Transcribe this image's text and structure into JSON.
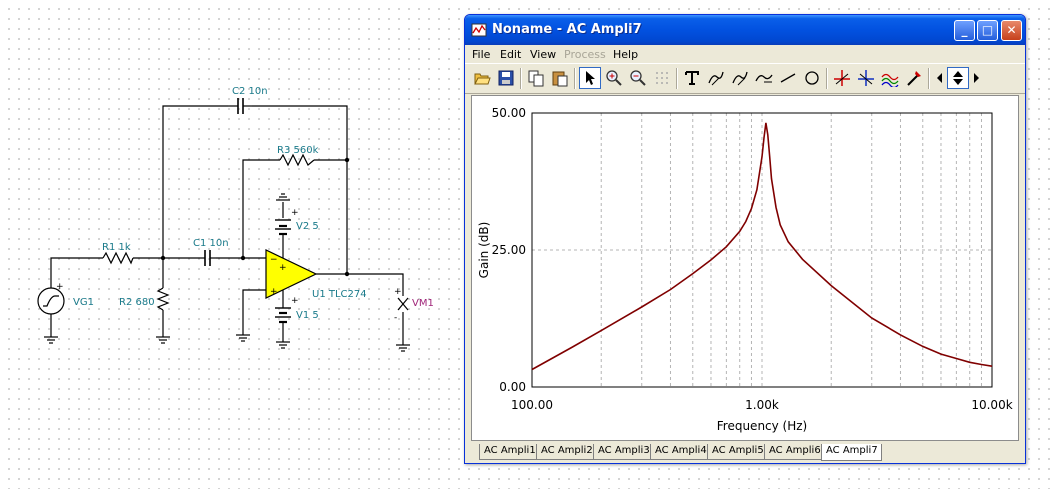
{
  "schematic": {
    "components": {
      "c2": "C2 10n",
      "r3": "R3 560k",
      "v2": "V2 5",
      "r1": "R1 1k",
      "c1": "C1 10n",
      "r2": "R2 680",
      "vg1": "VG1",
      "u1": "U1 TLC274",
      "vm1": "VM1",
      "v1": "V1 5"
    },
    "colors": {
      "wire": "#000000",
      "label": "#1a7a8a",
      "opamp_fill": "#ffff00",
      "meter_label": "#a0267a"
    }
  },
  "window": {
    "title": "Noname - AC Ampli7",
    "controls": {
      "minimize": "_",
      "maximize": "□",
      "close": "✕"
    },
    "menu": [
      {
        "label": "File",
        "enabled": true
      },
      {
        "label": "Edit",
        "enabled": true
      },
      {
        "label": "View",
        "enabled": true
      },
      {
        "label": "Process",
        "enabled": false
      },
      {
        "label": "Help",
        "enabled": true
      }
    ],
    "toolbar_icons": [
      "open-icon",
      "save-icon",
      "copy-icon",
      "paste-icon",
      "pointer-icon",
      "zoom-in-icon",
      "zoom-out-icon",
      "grid-icon",
      "text-icon",
      "annotate-a-icon",
      "annotate-b-icon",
      "trace-icon",
      "line-icon",
      "circle-icon",
      "cursor-a-icon",
      "cursor-b-icon",
      "curves-icon",
      "marker-icon",
      "arrow-left-icon",
      "arrow-updown-icon",
      "arrow-right-icon"
    ],
    "tabs": [
      {
        "label": "AC Ampli1",
        "active": false
      },
      {
        "label": "AC Ampli2",
        "active": false
      },
      {
        "label": "AC Ampli3",
        "active": false
      },
      {
        "label": "AC Ampli4",
        "active": false
      },
      {
        "label": "AC Ampli5",
        "active": false
      },
      {
        "label": "AC Ampli6",
        "active": false
      },
      {
        "label": "AC Ampli7",
        "active": true
      }
    ]
  },
  "chart_data": {
    "type": "line",
    "xlabel": "Frequency (Hz)",
    "ylabel": "Gain (dB)",
    "x_scale": "log",
    "xlim": [
      100,
      10000
    ],
    "ylim": [
      0,
      50
    ],
    "x_tick_labels": [
      "100.00",
      "1.00k",
      "10.00k"
    ],
    "y_tick_labels": [
      "0.00",
      "25.00",
      "50.00"
    ],
    "grid": true,
    "line_color": "#800000",
    "series": [
      {
        "x": [
          100,
          150,
          200,
          300,
          400,
          500,
          600,
          700,
          800,
          850,
          900,
          950,
          1000,
          1020,
          1040,
          1060,
          1080,
          1100,
          1150,
          1200,
          1300,
          1500,
          2000,
          3000,
          4000,
          5000,
          6000,
          7000,
          8000,
          9000,
          10000
        ],
        "y": [
          3.2,
          7.3,
          10.3,
          14.6,
          17.8,
          20.7,
          23.2,
          25.6,
          28.4,
          30.2,
          32.6,
          36.0,
          42.0,
          45.5,
          48.2,
          46.0,
          42.0,
          38.0,
          32.8,
          29.6,
          26.5,
          23.3,
          18.5,
          12.6,
          9.5,
          7.4,
          6.0,
          5.2,
          4.5,
          4.1,
          3.8
        ]
      }
    ]
  }
}
